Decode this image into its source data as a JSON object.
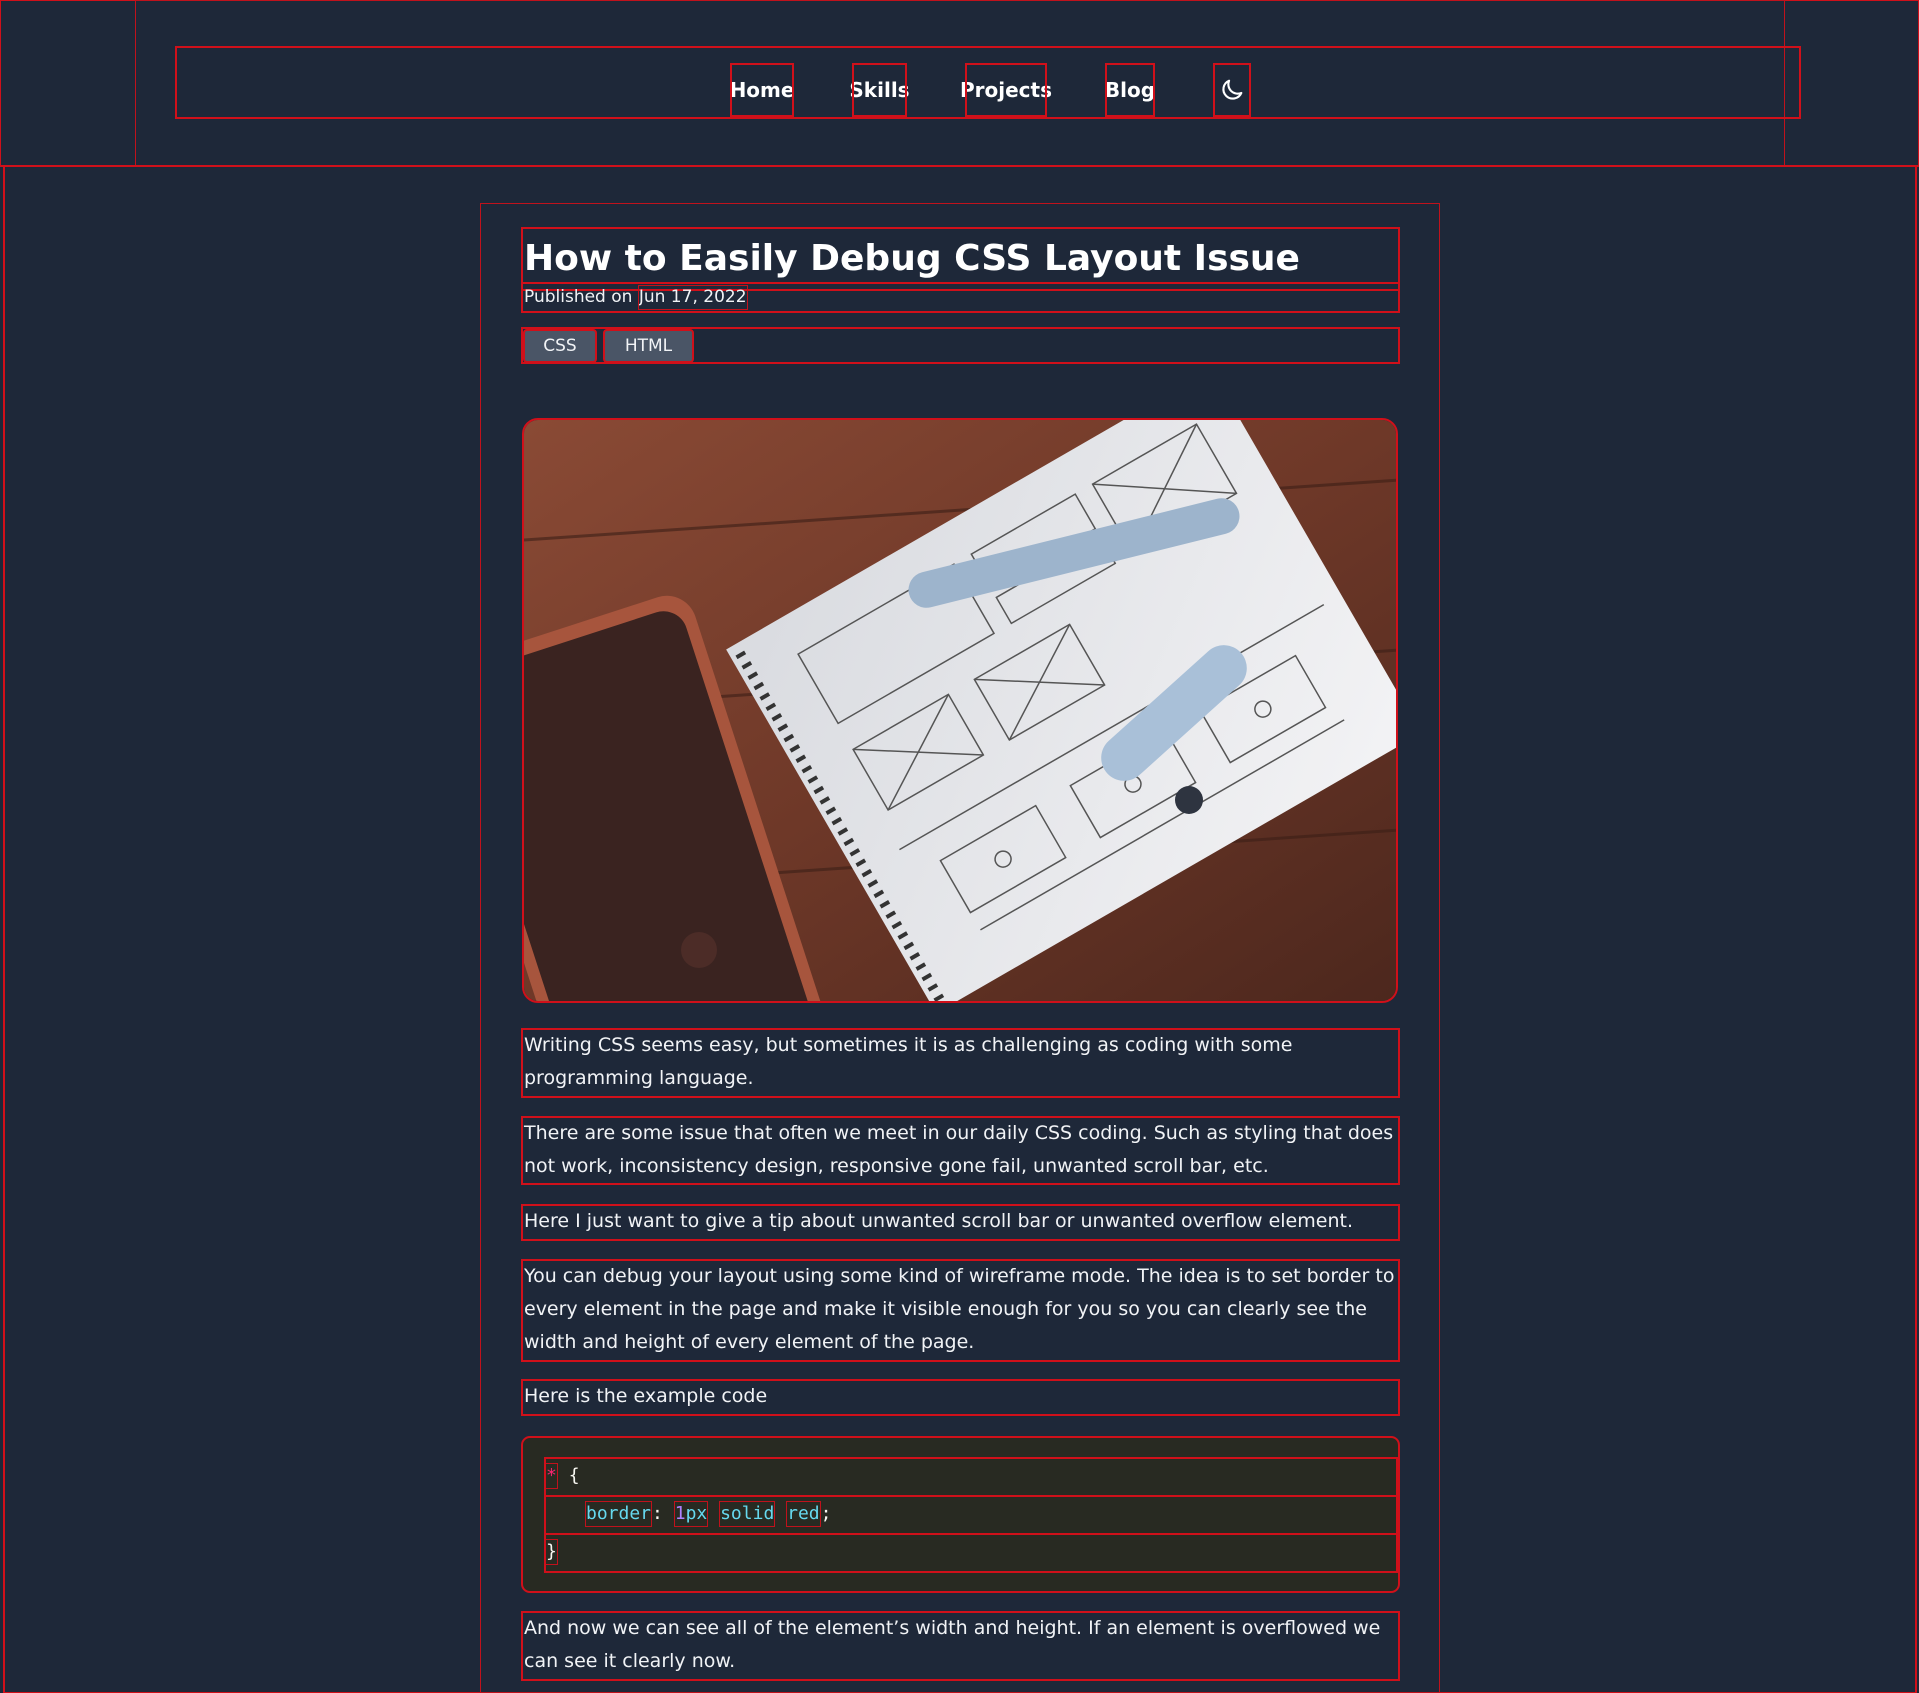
{
  "nav": {
    "items": [
      {
        "label": "Home"
      },
      {
        "label": "Skills"
      },
      {
        "label": "Projects"
      },
      {
        "label": "Blog"
      }
    ],
    "theme_toggle_icon": "moon-icon"
  },
  "article": {
    "title": "How to Easily Debug CSS Layout Issue",
    "published_prefix": "Published on",
    "published_date": "Jun 17, 2022",
    "tags": [
      "CSS",
      "HTML"
    ],
    "paragraphs": [
      "Writing CSS seems easy, but sometimes it is as challenging as coding with some programming language.",
      "There are some issue that often we meet in our daily CSS coding. Such as styling that does not work, inconsistency design, responsive gone fail, unwanted scroll bar, etc.",
      "Here I just want to give a tip about unwanted scroll bar or unwanted overflow element.",
      "You can debug your layout using some kind of wireframe mode. The idea is to set border to every element in the page and make it visible enough for you so you can clearly see the width and height of every element of the page.",
      "Here is the example code",
      "And now we can see all of the element’s width and height. If an element is overflowed we can see it clearly now."
    ],
    "code": {
      "selector": "*",
      "open_brace": "{",
      "property": "border",
      "colon": ":",
      "number": "1",
      "unit": "px",
      "style": "solid",
      "color_value": "red",
      "semicolon": ";",
      "close_brace": "}"
    }
  },
  "colors": {
    "background": "#1e2839",
    "wireframe_border": "#d0101a",
    "tag_background": "#4a5566",
    "code_background": "#282a22"
  }
}
